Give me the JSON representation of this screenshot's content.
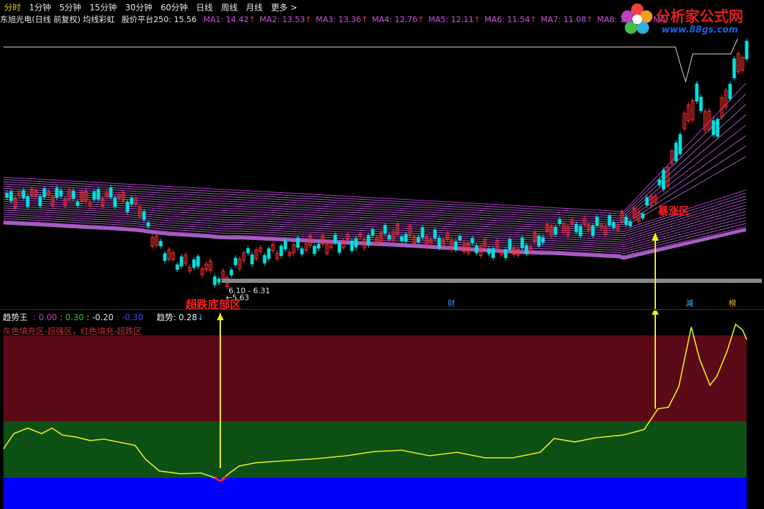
{
  "toolbar": {
    "periods": [
      "分时",
      "1分钟",
      "5分钟",
      "15分钟",
      "30分钟",
      "60分钟",
      "日线",
      "周线",
      "月线",
      "更多 >"
    ],
    "active_period": "分时"
  },
  "header": {
    "stock": "东旭光电(日线 前复权) 均线彩虹",
    "platform": "股价平台250: 15.56",
    "mas": [
      {
        "label": "MA1:",
        "value": "14.42"
      },
      {
        "label": "MA2:",
        "value": "13.53"
      },
      {
        "label": "MA3:",
        "value": "13.36"
      },
      {
        "label": "MA4:",
        "value": "12.76"
      },
      {
        "label": "MA5:",
        "value": "12.11"
      },
      {
        "label": "MA6:",
        "value": "11.54"
      },
      {
        "label": "MA7:",
        "value": "11.08"
      },
      {
        "label": "MA8:",
        "value": "10.72"
      },
      {
        "label": "MA",
        "value": ""
      }
    ]
  },
  "logo": {
    "brand": "分析家公式网",
    "url": "www.88gs.com"
  },
  "main_chart": {
    "range_label": "6.10 - 6.31",
    "low_label": "5.63",
    "annotation_bottom": "超跌底部区",
    "annotation_top": "暴涨区",
    "event_markers": [
      "财",
      "減",
      "榜"
    ]
  },
  "indicator": {
    "name": "趋势王",
    "levels": [
      {
        "label": ": 0.00",
        "color": "#c040c0"
      },
      {
        "label": ": 0.30",
        "color": "#40c040"
      },
      {
        "label": ": -0.20",
        "color": "#e0e0e0"
      },
      {
        "label": ": -0.30",
        "color": "#4040ff"
      }
    ],
    "trend_label": "趋势: 0.28",
    "description": "灰色填充区-超强区，红色填充-超跌区"
  },
  "colors": {
    "up": "#ff3030",
    "down": "#00e0e0",
    "rainbow": "#d050e0",
    "trend": "#f0f020",
    "zone_red": "#5c0a18",
    "zone_green": "#0d5014",
    "zone_blue": "#0000ff"
  }
}
